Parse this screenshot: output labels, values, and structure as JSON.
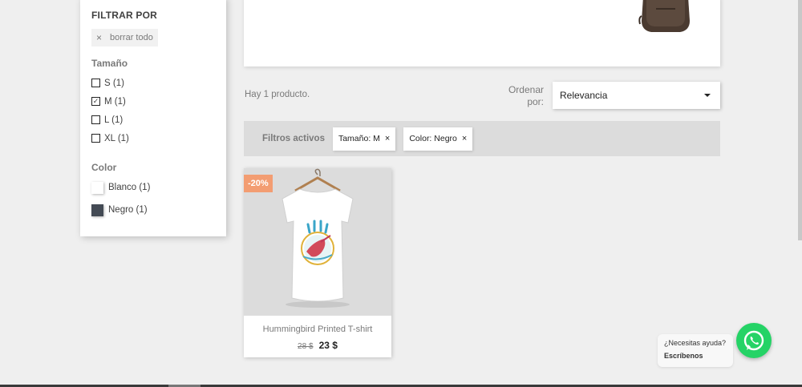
{
  "sidebar": {
    "title": "FILTRAR POR",
    "clear_all": "borrar todo",
    "clear_icon": "×",
    "size_facet": {
      "title": "Tamaño",
      "options": [
        {
          "label": "S (1)",
          "checked": false
        },
        {
          "label": "M (1)",
          "checked": true
        },
        {
          "label": "L (1)",
          "checked": false
        },
        {
          "label": "XL (1)",
          "checked": false
        }
      ]
    },
    "color_facet": {
      "title": "Color",
      "options": [
        {
          "label": "Blanco (1)",
          "color": "#ffffff"
        },
        {
          "label": "Negro (1)",
          "color": "#434a54"
        }
      ]
    }
  },
  "listing": {
    "count_text": "Hay 1 producto.",
    "sort_label": "Ordenar por:",
    "sort_value": "Relevancia"
  },
  "active_filters": {
    "label": "Filtros activos",
    "chips": [
      {
        "label": "Tamaño: M",
        "close": "×"
      },
      {
        "label": "Color: Negro",
        "close": "×"
      }
    ]
  },
  "product": {
    "badge": "-20%",
    "title": "Hummingbird Printed T-shirt",
    "old_price": "28 $",
    "price": "23 $"
  },
  "whatsapp": {
    "question": "¿Necesitas ayuda?",
    "cta": "Escríbenos"
  },
  "colors": {
    "badge": "#f39d72",
    "whatsapp": "#25d366"
  }
}
